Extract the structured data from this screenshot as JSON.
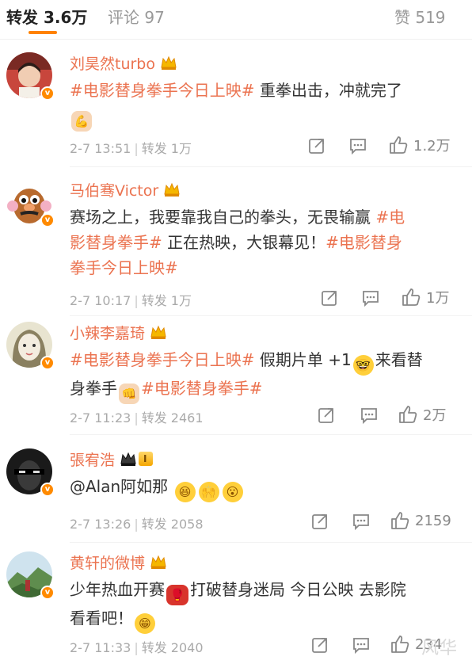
{
  "tabs": {
    "repost": "转发 3.6万",
    "comment": "评论 97",
    "like": "赞 519"
  },
  "accent_color": "#ff8200",
  "name_color": "#eb7350",
  "comments": [
    {
      "username": "刘昊然turbo",
      "badge": "crown-icon",
      "text_parts": [
        {
          "type": "tag",
          "value": "#电影替身拳手今日上映#"
        },
        {
          "type": "text",
          "value": " 重拳出击，冲就完了"
        }
      ],
      "emoji": "flexed-biceps-emoji",
      "date": "2-7 13:51",
      "repost": "转发 1万",
      "likes": "1.2万"
    },
    {
      "username": "马伯骞Victor",
      "badge": "crown-icon",
      "text_line1": "赛场之上，我要靠我自己的拳头，无畏输赢 ",
      "text_tag1": "#电",
      "text_line2a": "影替身拳手#",
      "text_line2b": " 正在热映，大银幕见！",
      "text_tag2": "#电影替身",
      "text_line3": "拳手今日上映#",
      "date": "2-7 10:17",
      "repost": "转发 1万",
      "likes": "1万"
    },
    {
      "username": "小辣李嘉琦",
      "badge": "crown-icon",
      "tag1": "#电影替身拳手今日上映#",
      "text1": " 假期片单 +1",
      "emoji1": "nerd-face-emoji",
      "text2": "来看替",
      "text3": "身拳手",
      "emoji2": "fist-emoji",
      "tag2": "#电影替身拳手#",
      "date": "2-7 11:23",
      "repost": "转发 2461",
      "likes": "2万"
    },
    {
      "username": "張宥浩",
      "badge": "crown-level-badge",
      "level_text": "I",
      "text": "@Alan阿如那",
      "emojis": [
        "excited-emoji",
        "cheer-emoji",
        "surprised-emoji"
      ],
      "date": "2-7 13:26",
      "repost": "转发 2058",
      "likes": "2159"
    },
    {
      "username": "黄轩的微博",
      "badge": "crown-icon",
      "text1": "少年热血开赛",
      "emoji1": "boxing-glove-emoji",
      "text2": "打破替身迷局 今日公映 去影院",
      "text3": "看看吧！",
      "emoji2": "grinning-emoji",
      "date": "2-7 11:33",
      "repost": "转发 2040",
      "likes": "234"
    }
  ],
  "watermark": "风华"
}
